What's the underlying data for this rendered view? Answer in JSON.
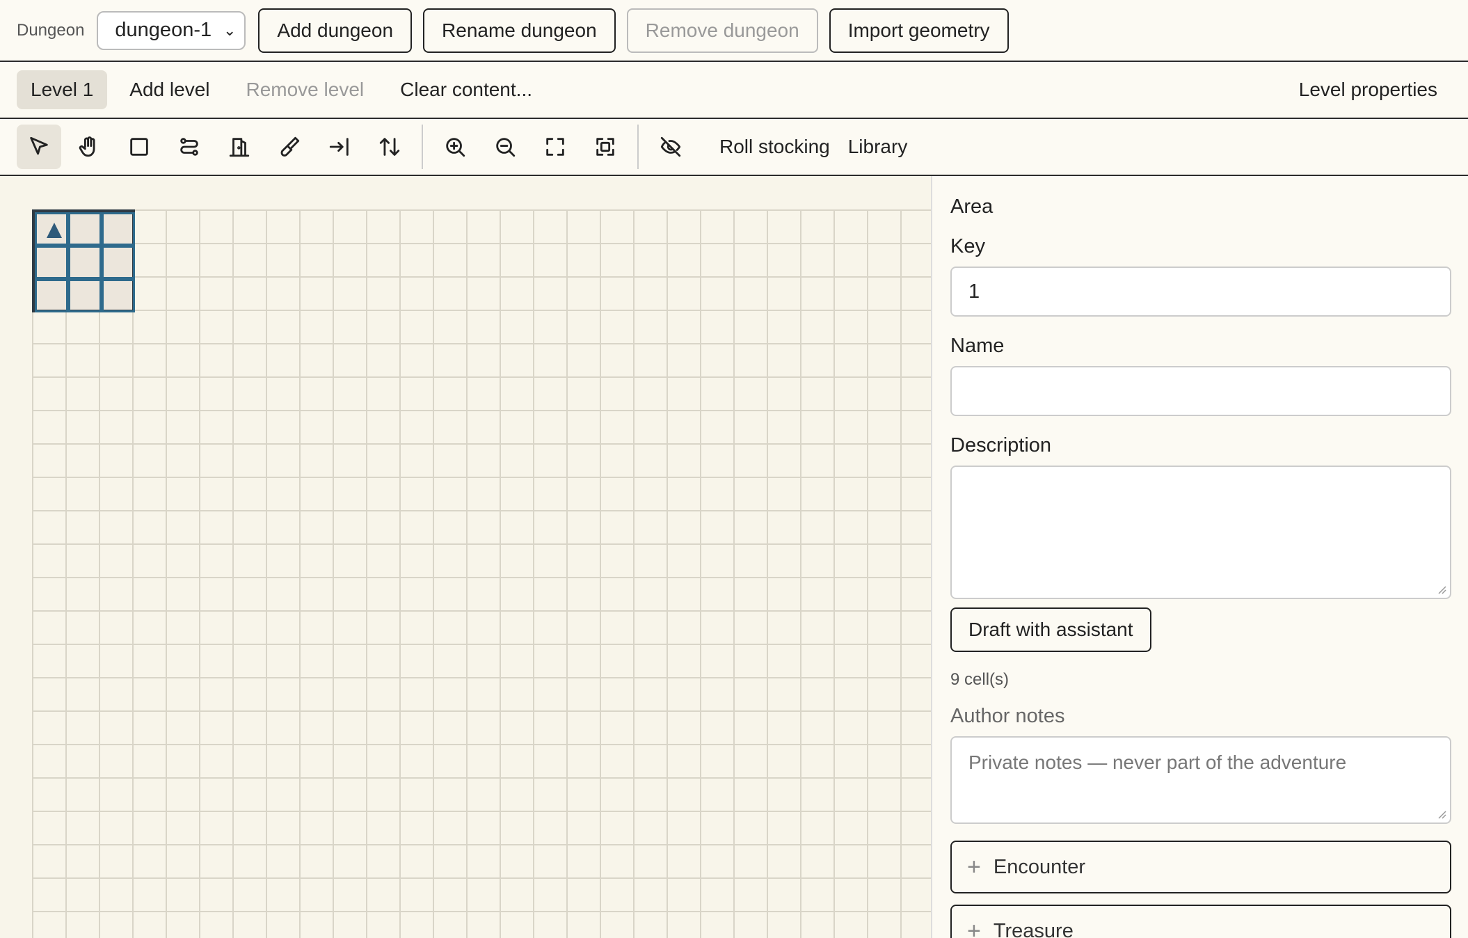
{
  "topbar": {
    "dungeon_label": "Dungeon",
    "dungeon_select": "dungeon-1",
    "add_dungeon": "Add dungeon",
    "rename_dungeon": "Rename dungeon",
    "remove_dungeon": "Remove dungeon",
    "import_geometry": "Import geometry"
  },
  "levelbar": {
    "level_tab": "Level 1",
    "add_level": "Add level",
    "remove_level": "Remove level",
    "clear_content": "Clear content...",
    "level_properties": "Level properties"
  },
  "toolbar": {
    "tools": [
      "select-icon",
      "pan-hand-icon",
      "room-rect-icon",
      "corridor-icon",
      "door-icon",
      "paint-brush-icon",
      "entrance-icon",
      "stairs-icon"
    ],
    "view_tools": [
      "zoom-in-icon",
      "zoom-out-icon",
      "fit-view-icon",
      "focus-selection-icon"
    ],
    "visibility_icon": "eye-off-icon",
    "roll_stocking": "Roll stocking",
    "library": "Library"
  },
  "canvas": {
    "selected_room_cells": 9
  },
  "panel": {
    "title": "Area",
    "key_label": "Key",
    "key_value": "1",
    "name_label": "Name",
    "name_value": "",
    "description_label": "Description",
    "description_value": "",
    "draft_button": "Draft with assistant",
    "cells_count": "9 cell(s)",
    "author_notes_label": "Author notes",
    "author_notes_placeholder": "Private notes — never part of the adventure",
    "sections": [
      "Encounter",
      "Treasure"
    ]
  },
  "colors": {
    "background": "#fcfaf3",
    "room_border": "#2e6a8c",
    "grid_line": "#d9d5c8"
  }
}
